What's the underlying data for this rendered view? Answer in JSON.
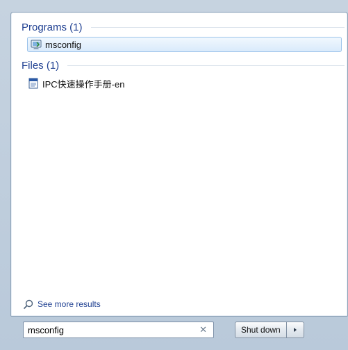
{
  "sections": {
    "programs": {
      "title": "Programs (1)",
      "items": [
        {
          "label": "msconfig",
          "icon": "system-configuration-icon",
          "selected": true
        }
      ]
    },
    "files": {
      "title": "Files (1)",
      "items": [
        {
          "label": "IPC快速操作手册-en",
          "icon": "document-icon",
          "selected": false
        }
      ]
    }
  },
  "see_more": {
    "label": "See more results",
    "icon": "search-icon"
  },
  "search": {
    "value": "msconfig",
    "clear_icon": "clear-icon"
  },
  "shutdown": {
    "label": "Shut down",
    "arrow_icon": "triangle-right-icon"
  },
  "colors": {
    "header_text": "#1e3f91",
    "selection_border": "#9cc3ea",
    "selection_fill": "#d9eafb"
  }
}
